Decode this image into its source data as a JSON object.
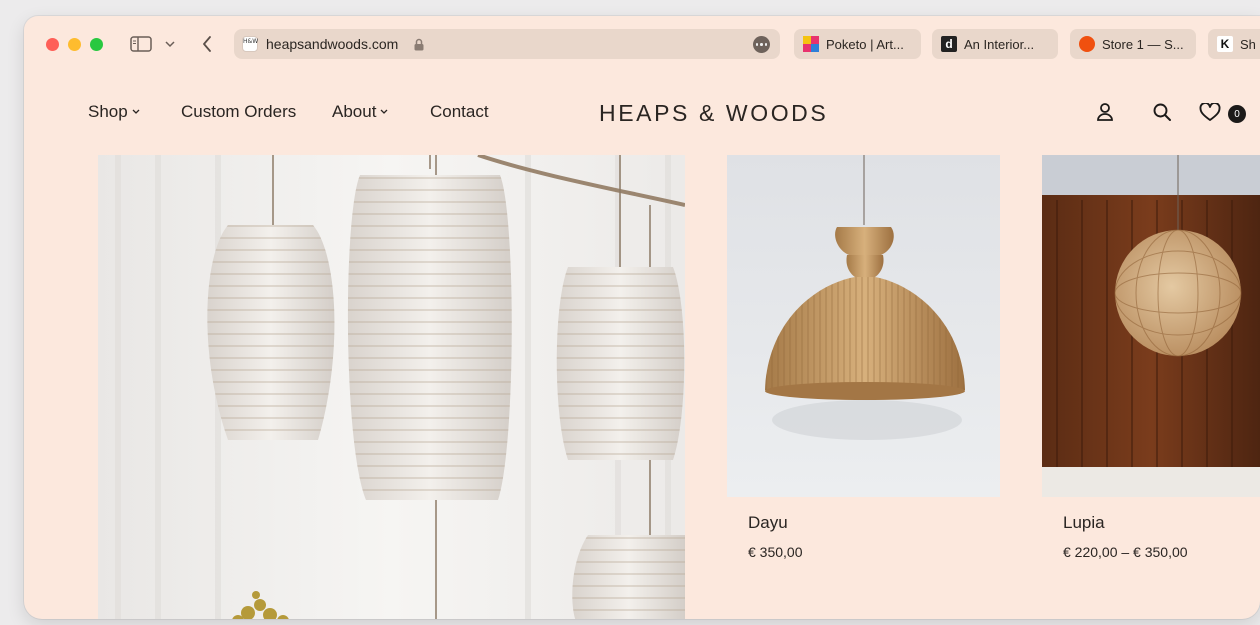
{
  "browser": {
    "url": "heapsandwoods.com",
    "favicon_text": "H&W",
    "tabs": [
      {
        "label": "Poketo | Art..."
      },
      {
        "label": "An Interior..."
      },
      {
        "label": "Store 1 — S..."
      },
      {
        "label": "Sh"
      }
    ],
    "tab_favicon_letters": {
      "interior": "d",
      "last": "K"
    }
  },
  "site": {
    "nav": [
      {
        "label": "Shop"
      },
      {
        "label": "Custom Orders"
      },
      {
        "label": "About"
      },
      {
        "label": "Contact"
      }
    ],
    "logo": "HEAPS & WOODS",
    "cart_count": "0"
  },
  "products": [
    {
      "name": "Dayu",
      "price": "€ 350,00"
    },
    {
      "name": "Lupia",
      "price": "€ 220,00 – € 350,00"
    }
  ],
  "icons": {
    "toolbar": [
      "sidebar-icon",
      "chevron-down-icon",
      "back-icon",
      "lock-icon",
      "more-icon"
    ],
    "header": [
      "account-icon",
      "search-icon",
      "heart-icon"
    ]
  },
  "colors": {
    "page_background": "#fce8dd",
    "address_bar": "#e9d7cb",
    "text": "#2a2522",
    "badge": "#1c1a19"
  }
}
